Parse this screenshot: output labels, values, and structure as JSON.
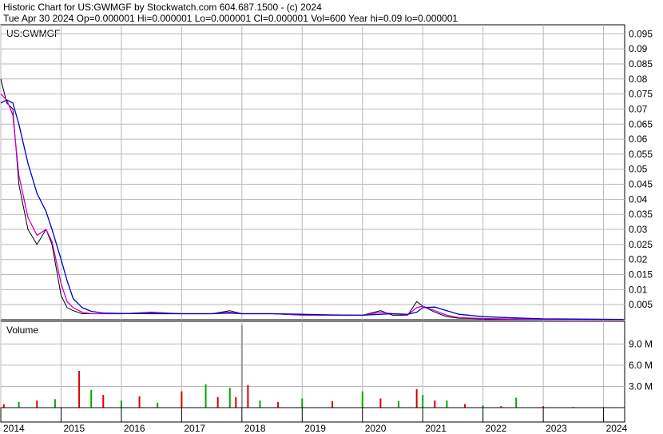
{
  "header": {
    "line1": "Historic Chart for US:GWMGF by Stockwatch.com 604.687.1500 - (c) 2024",
    "line2": "Tue Apr 30 2024   Op=0.000001  Hi=0.000001  Lo=0.000001  Cl=0.000001  Vol=600  Year hi=0.09  lo=0.000001"
  },
  "colors": {
    "price": "#000000",
    "ma_short": "#cc00cc",
    "ma_long": "#0000cc",
    "up_volume": "#00aa00",
    "down_volume": "#dd0000",
    "flat_volume": "#999999",
    "grid": "#b8b8b8"
  },
  "chart_data": [
    {
      "type": "line",
      "symbol_label": "US:GWMGF",
      "x": [
        2014.0,
        2014.1,
        2014.2,
        2014.3,
        2014.45,
        2014.6,
        2014.75,
        2014.85,
        2015.0,
        2015.1,
        2015.2,
        2015.35,
        2015.5,
        2015.7,
        2016.0,
        2016.5,
        2017.0,
        2017.5,
        2017.8,
        2018.0,
        2018.5,
        2019.0,
        2019.5,
        2020.0,
        2020.3,
        2020.5,
        2020.75,
        2020.9,
        2021.0,
        2021.2,
        2021.4,
        2021.6,
        2022.0,
        2022.5,
        2023.0,
        2023.5,
        2024.33
      ],
      "series": [
        {
          "values": [
            0.08,
            0.072,
            0.07,
            0.045,
            0.03,
            0.025,
            0.03,
            0.025,
            0.008,
            0.004,
            0.003,
            0.002,
            0.002,
            0.002,
            0.002,
            0.0025,
            0.002,
            0.002,
            0.003,
            0.002,
            0.002,
            0.0015,
            0.0015,
            0.0015,
            0.003,
            0.0015,
            0.0015,
            0.006,
            0.0045,
            0.0025,
            0.001,
            0.0005,
            0.0003,
            0.0002,
            0.0001,
            5e-05,
            1e-06
          ]
        },
        {
          "values": [
            0.075,
            0.073,
            0.068,
            0.048,
            0.034,
            0.028,
            0.03,
            0.026,
            0.012,
            0.006,
            0.004,
            0.0025,
            0.002,
            0.002,
            0.002,
            0.0022,
            0.002,
            0.002,
            0.0025,
            0.002,
            0.002,
            0.0016,
            0.0015,
            0.0015,
            0.0025,
            0.002,
            0.0016,
            0.004,
            0.0045,
            0.003,
            0.0015,
            0.0007,
            0.0004,
            0.0002,
            0.0001,
            5e-05,
            1e-05
          ]
        },
        {
          "values": [
            0.072,
            0.073,
            0.072,
            0.065,
            0.052,
            0.042,
            0.036,
            0.03,
            0.02,
            0.013,
            0.007,
            0.004,
            0.0028,
            0.0022,
            0.0021,
            0.002,
            0.002,
            0.002,
            0.0022,
            0.002,
            0.002,
            0.0018,
            0.0016,
            0.0015,
            0.0018,
            0.002,
            0.0018,
            0.0025,
            0.004,
            0.0042,
            0.003,
            0.0018,
            0.001,
            0.0006,
            0.0003,
            0.0002,
            0.0001
          ]
        }
      ],
      "ylim": [
        0,
        0.098
      ],
      "yticks": [
        0.005,
        0.01,
        0.015,
        0.02,
        0.025,
        0.03,
        0.035,
        0.04,
        0.045,
        0.05,
        0.055,
        0.06,
        0.065,
        0.07,
        0.075,
        0.08,
        0.085,
        0.09,
        0.095
      ],
      "ytick_labels": [
        "0.005",
        "0.01",
        "0.015",
        "0.02",
        "0.025",
        "0.03",
        "0.035",
        "0.04",
        "0.045",
        "0.05",
        "0.055",
        "0.06",
        "0.065",
        "0.07",
        "0.075",
        "0.08",
        "0.085",
        "0.09",
        "0.095"
      ],
      "xlim": [
        2014.0,
        2024.35
      ],
      "grid": true
    },
    {
      "type": "bar",
      "ylabel": "Volume",
      "x": [
        2014.05,
        2014.3,
        2014.6,
        2014.9,
        2015.3,
        2015.5,
        2015.7,
        2016.0,
        2016.3,
        2016.6,
        2017.0,
        2017.4,
        2017.6,
        2017.8,
        2017.9,
        2018.0,
        2018.1,
        2018.3,
        2018.6,
        2019.0,
        2019.5,
        2020.0,
        2020.3,
        2020.6,
        2020.9,
        2021.0,
        2021.2,
        2021.4,
        2021.7,
        2022.0,
        2022.3,
        2022.55,
        2023.0,
        2023.5
      ],
      "values": [
        0.5,
        0.8,
        1.0,
        1.2,
        5.2,
        2.5,
        1.8,
        1.0,
        1.6,
        0.7,
        2.3,
        3.3,
        1.5,
        2.8,
        1.5,
        11.7,
        3.2,
        1.0,
        0.8,
        1.3,
        0.9,
        2.3,
        1.3,
        0.9,
        2.6,
        1.8,
        1.0,
        1.0,
        0.5,
        0.3,
        0.2,
        1.4,
        0.2,
        0.1
      ],
      "ylim": [
        0,
        12.2
      ],
      "yticks": [
        3,
        6,
        9
      ],
      "ytick_labels": [
        "3.0 M",
        "6.0 M",
        "9.0 M"
      ],
      "xtick_labels": [
        "2014",
        "2015",
        "2016",
        "2017",
        "2018",
        "2019",
        "2020",
        "2021",
        "2022",
        "2023",
        "2024"
      ],
      "xticks": [
        2014,
        2015,
        2016,
        2017,
        2018,
        2019,
        2020,
        2021,
        2022,
        2023,
        2024
      ]
    }
  ]
}
